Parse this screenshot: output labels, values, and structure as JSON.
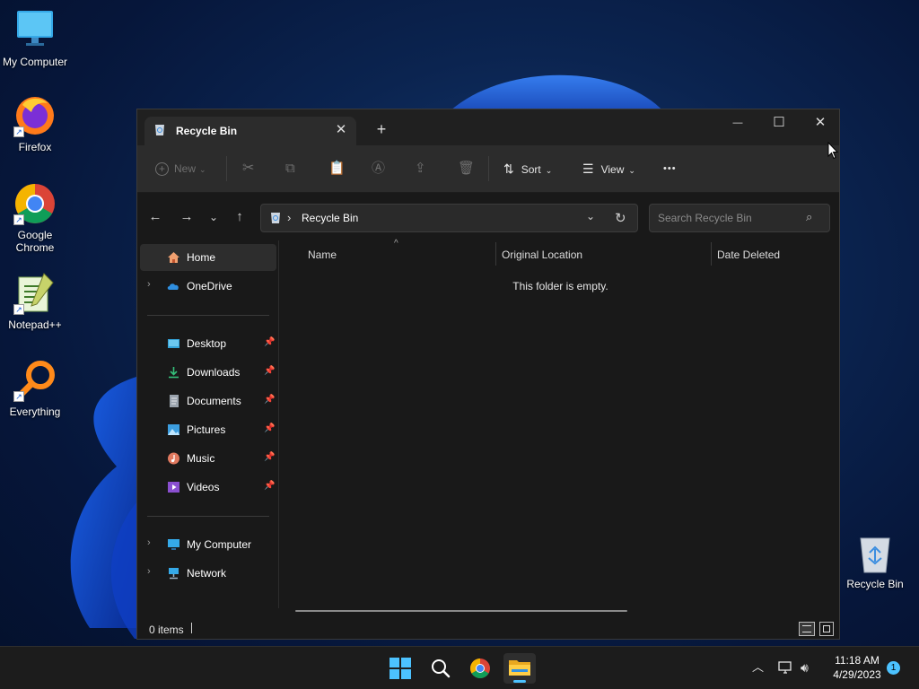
{
  "desktop": {
    "icons": [
      {
        "label": "My Computer",
        "icon": "computer-monitor-icon"
      },
      {
        "label": "Firefox",
        "icon": "firefox-icon"
      },
      {
        "label": "Google\nChrome",
        "icon": "chrome-icon"
      },
      {
        "label": "Notepad++",
        "icon": "notepadpp-icon"
      },
      {
        "label": "Everything",
        "icon": "everything-search-icon"
      }
    ],
    "recycle_bin": {
      "label": "Recycle Bin",
      "icon": "recycle-bin-icon"
    }
  },
  "window": {
    "tab_title": "Recycle Bin",
    "tab_close": "✕",
    "new_tab": "+",
    "controls": {
      "minimize": "—",
      "maximize": "☐",
      "close": "✕"
    },
    "toolbar": {
      "new_label": "New",
      "sort_label": "Sort",
      "view_label": "View",
      "more": "•••"
    },
    "address": {
      "crumb_sep": "›",
      "location": "Recycle Bin",
      "search_placeholder": "Search Recycle Bin"
    },
    "sidebar": {
      "home": "Home",
      "onedrive": "OneDrive",
      "quick": [
        {
          "label": "Desktop",
          "icon": "desktop-folder-icon"
        },
        {
          "label": "Downloads",
          "icon": "downloads-icon"
        },
        {
          "label": "Documents",
          "icon": "documents-icon"
        },
        {
          "label": "Pictures",
          "icon": "pictures-icon"
        },
        {
          "label": "Music",
          "icon": "music-icon"
        },
        {
          "label": "Videos",
          "icon": "videos-icon"
        }
      ],
      "my_computer": "My Computer",
      "network": "Network"
    },
    "columns": {
      "name": "Name",
      "original_location": "Original Location",
      "date_deleted": "Date Deleted"
    },
    "empty_message": "This folder is empty.",
    "status": {
      "items": "0 items"
    }
  },
  "taskbar": {
    "time": "11:18 AM",
    "date": "4/29/2023",
    "notification_count": "1",
    "apps": [
      "start-icon",
      "search-icon",
      "chrome-icon",
      "file-explorer-icon"
    ]
  },
  "colors": {
    "window_bg": "#191919",
    "toolbar_bg": "#2c2c2c",
    "taskbar_bg": "#1c1c1c",
    "accent": "#4cc2ff"
  }
}
